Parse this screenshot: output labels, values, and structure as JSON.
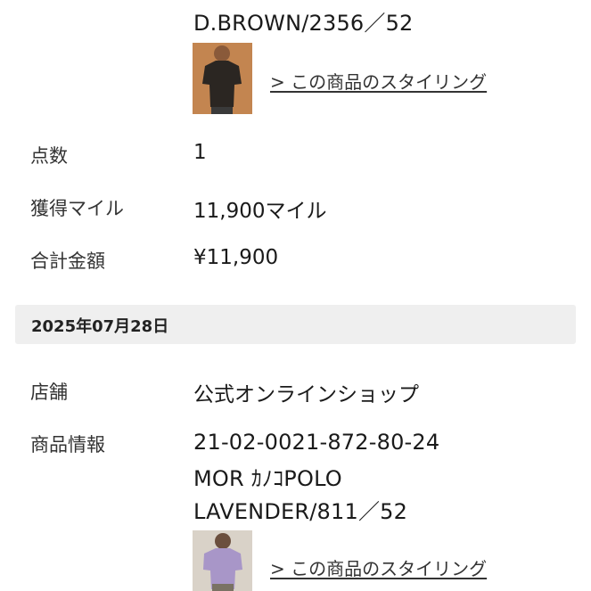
{
  "order_top": {
    "product_line": "D.BROWN/2356／52",
    "styling_link": "> この商品のスタイリング",
    "rows": [
      {
        "label": "点数",
        "value": "1"
      },
      {
        "label": "獲得マイル",
        "value": "11,900マイル"
      },
      {
        "label": "合計金額",
        "value": "¥11,900"
      }
    ]
  },
  "order_bottom": {
    "date": "2025年07月28日",
    "store_label": "店舗",
    "store_value": "公式オンラインショップ",
    "product_label": "商品情報",
    "product_lines": [
      "21-02-0021-872-80-24",
      "MOR ｶﾉｺPOLO",
      "LAVENDER/811／52"
    ],
    "styling_link": "> この商品のスタイリング"
  },
  "colors": {
    "date_bar_bg": "#efefef",
    "brown_shirt": "#2b2622",
    "lavender_shirt": "#a896c8"
  }
}
